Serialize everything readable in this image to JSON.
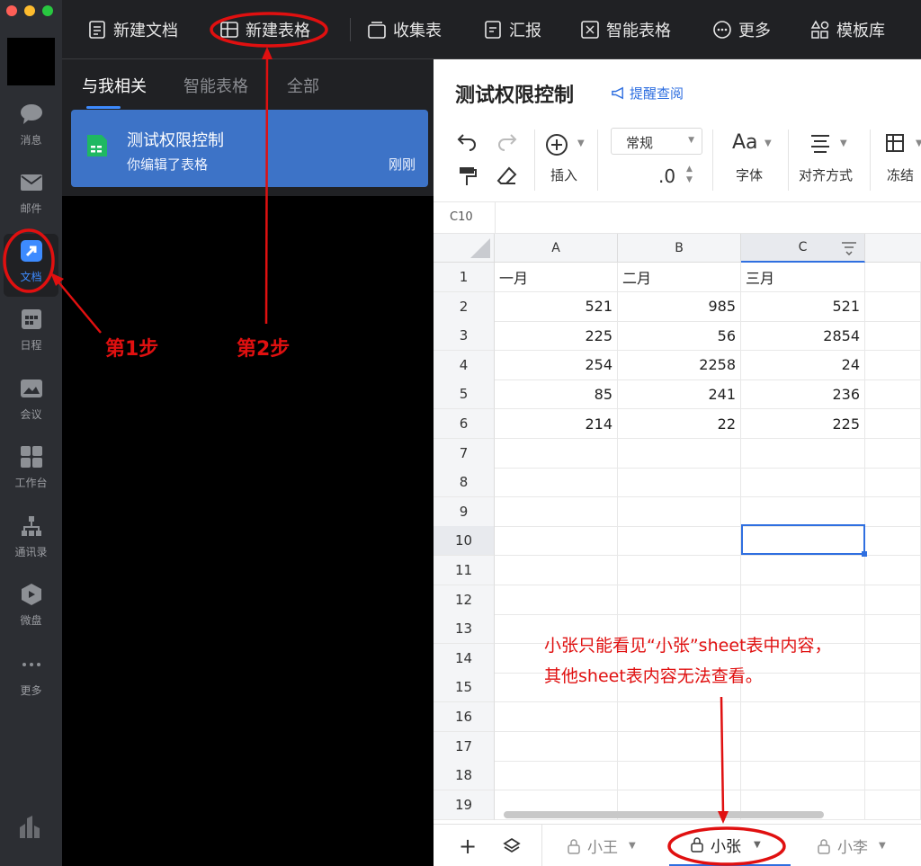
{
  "nav": {
    "items": [
      {
        "label": "消息",
        "icon": "message-icon"
      },
      {
        "label": "邮件",
        "icon": "mail-icon"
      },
      {
        "label": "文档",
        "icon": "document-icon"
      },
      {
        "label": "日程",
        "icon": "calendar-icon"
      },
      {
        "label": "会议",
        "icon": "meeting-icon"
      },
      {
        "label": "工作台",
        "icon": "workbench-icon"
      },
      {
        "label": "通讯录",
        "icon": "contacts-icon"
      },
      {
        "label": "微盘",
        "icon": "drive-icon"
      },
      {
        "label": "更多",
        "icon": "more-icon"
      }
    ],
    "active": "文档"
  },
  "toolbar": {
    "new_doc": "新建文档",
    "new_sheet": "新建表格",
    "collect": "收集表",
    "report": "汇报",
    "smart_sheet": "智能表格",
    "more": "更多",
    "templates": "模板库"
  },
  "left_panel": {
    "tabs": [
      "与我相关",
      "智能表格",
      "全部"
    ],
    "active_tab": "与我相关",
    "doc": {
      "title": "测试权限控制",
      "subtitle": "你编辑了表格",
      "time": "刚刚"
    }
  },
  "sheet": {
    "title": "测试权限控制",
    "remind": "提醒查阅",
    "ribbon": {
      "format": "常规",
      "decimal": ".0",
      "insert": "插入",
      "font": "字体",
      "align": "对齐方式",
      "freeze": "冻结"
    },
    "cell_ref": "C10",
    "columns": [
      "A",
      "B",
      "C"
    ],
    "rows": [
      "1",
      "2",
      "3",
      "4",
      "5",
      "6",
      "7",
      "8",
      "9",
      "10",
      "11",
      "12",
      "13",
      "14",
      "15",
      "16",
      "17",
      "18",
      "19"
    ],
    "cells": [
      [
        "一月",
        "二月",
        "三月"
      ],
      [
        "521",
        "985",
        "521"
      ],
      [
        "225",
        "56",
        "2854"
      ],
      [
        "254",
        "2258",
        "24"
      ],
      [
        "85",
        "241",
        "236"
      ],
      [
        "214",
        "22",
        "225"
      ]
    ],
    "sheet_tabs": [
      {
        "label": "小王",
        "active": false
      },
      {
        "label": "小张",
        "active": true
      },
      {
        "label": "小李",
        "active": false
      }
    ]
  },
  "annotations": {
    "step1": "第1步",
    "step2": "第2步",
    "note_line1": "小张只能看见“小张”sheet表中内容，",
    "note_line2": "其他sheet表内容无法查看。",
    "color": "#e01010"
  }
}
